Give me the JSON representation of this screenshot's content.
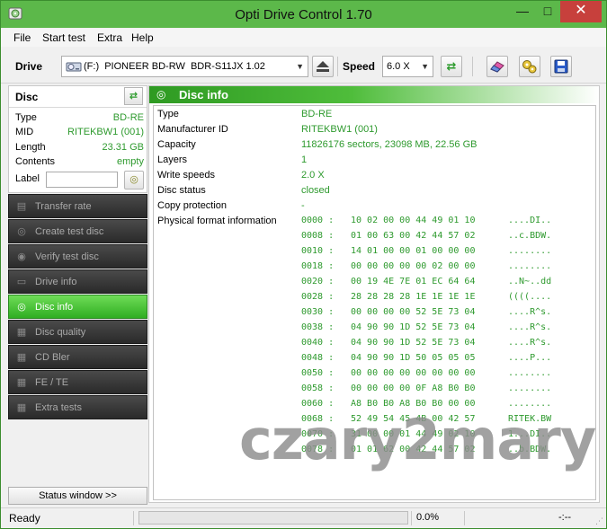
{
  "window": {
    "title": "Opti Drive Control 1.70",
    "minimize_glyph": "—",
    "maximize_glyph": "□",
    "close_glyph": "✕"
  },
  "menu": [
    "File",
    "Start test",
    "Extra",
    "Help"
  ],
  "toolbar": {
    "drive_label": "Drive",
    "drive_value": "(F:)  PIONEER BD-RW  BDR-S11JX 1.02",
    "speed_label": "Speed",
    "speed_value": "6.0 X"
  },
  "disc_panel": {
    "heading": "Disc",
    "fields": [
      {
        "key": "Type",
        "value": "BD-RE"
      },
      {
        "key": "MID",
        "value": "RITEKBW1 (001)"
      },
      {
        "key": "Length",
        "value": "23.31 GB"
      },
      {
        "key": "Contents",
        "value": "empty"
      }
    ],
    "label_key": "Label",
    "label_value": ""
  },
  "nav": [
    {
      "label": "Transfer rate",
      "icon": "chart-icon",
      "active": false
    },
    {
      "label": "Create test disc",
      "icon": "disc-burn-icon",
      "active": false
    },
    {
      "label": "Verify test disc",
      "icon": "disc-verify-icon",
      "active": false
    },
    {
      "label": "Drive info",
      "icon": "drive-icon",
      "active": false
    },
    {
      "label": "Disc info",
      "icon": "disc-info-icon",
      "active": true
    },
    {
      "label": "Disc quality",
      "icon": "quality-icon",
      "active": false
    },
    {
      "label": "CD Bler",
      "icon": "cd-bler-icon",
      "active": false
    },
    {
      "label": "FE / TE",
      "icon": "fe-te-icon",
      "active": false
    },
    {
      "label": "Extra tests",
      "icon": "extra-tests-icon",
      "active": false
    }
  ],
  "status_window_button": "Status window >>",
  "main": {
    "heading": "Disc info",
    "info_rows": [
      {
        "key": "Type",
        "value": "BD-RE"
      },
      {
        "key": "Manufacturer ID",
        "value": "RITEKBW1 (001)"
      },
      {
        "key": "Capacity",
        "value": "11826176 sectors, 23098 MB, 22.56 GB"
      },
      {
        "key": "Layers",
        "value": "1"
      },
      {
        "key": "Write speeds",
        "value": "2.0 X"
      },
      {
        "key": "Disc status",
        "value": "closed"
      },
      {
        "key": "Copy protection",
        "value": "-"
      },
      {
        "key": "Physical format information",
        "value": ""
      }
    ],
    "hex_rows": [
      {
        "offset": "0000 :",
        "bytes": "10 02 00 00 44 49 01 10",
        "ascii": "....DI.."
      },
      {
        "offset": "0008 :",
        "bytes": "01 00 63 00 42 44 57 02",
        "ascii": "..c.BDW."
      },
      {
        "offset": "0010 :",
        "bytes": "14 01 00 00 01 00 00 00",
        "ascii": "........"
      },
      {
        "offset": "0018 :",
        "bytes": "00 00 00 00 00 02 00 00",
        "ascii": "........"
      },
      {
        "offset": "0020 :",
        "bytes": "00 19 4E 7E 01 EC 64 64",
        "ascii": "..N~..dd"
      },
      {
        "offset": "0028 :",
        "bytes": "28 28 28 28 1E 1E 1E 1E",
        "ascii": "((((...."
      },
      {
        "offset": "0030 :",
        "bytes": "00 00 00 00 52 5E 73 04",
        "ascii": "....R^s."
      },
      {
        "offset": "0038 :",
        "bytes": "04 90 90 1D 52 5E 73 04",
        "ascii": "....R^s."
      },
      {
        "offset": "0040 :",
        "bytes": "04 90 90 1D 52 5E 73 04",
        "ascii": "....R^s."
      },
      {
        "offset": "0048 :",
        "bytes": "04 90 90 1D 50 05 05 05",
        "ascii": "....P..."
      },
      {
        "offset": "0050 :",
        "bytes": "00 00 00 00 00 00 00 00",
        "ascii": "........"
      },
      {
        "offset": "0058 :",
        "bytes": "00 00 00 00 0F A8 B0 B0",
        "ascii": "........"
      },
      {
        "offset": "0060 :",
        "bytes": "A8 B0 B0 A8 B0 B0 00 00",
        "ascii": "........"
      },
      {
        "offset": "0068 :",
        "bytes": "52 49 54 45 4B 00 42 57",
        "ascii": "RITEK.BW"
      },
      {
        "offset": "0070 :",
        "bytes": "31 00 00 01 44 49 02 10",
        "ascii": "1...DI.."
      },
      {
        "offset": "0078 :",
        "bytes": "01 01 62 00 42 44 57 02",
        "ascii": "..b.BDW."
      }
    ]
  },
  "watermark": "czary2mary",
  "statusbar": {
    "status": "Ready",
    "progress_fraction": 0.0,
    "progress_text": "0.0%",
    "elapsed": "-:--"
  },
  "colors": {
    "accent": "#3dba2a",
    "value_green": "#2e9a2e",
    "title_bar": "#5cb84a",
    "close_button": "#c7403c",
    "nav_dark": "#2a2a2a"
  }
}
